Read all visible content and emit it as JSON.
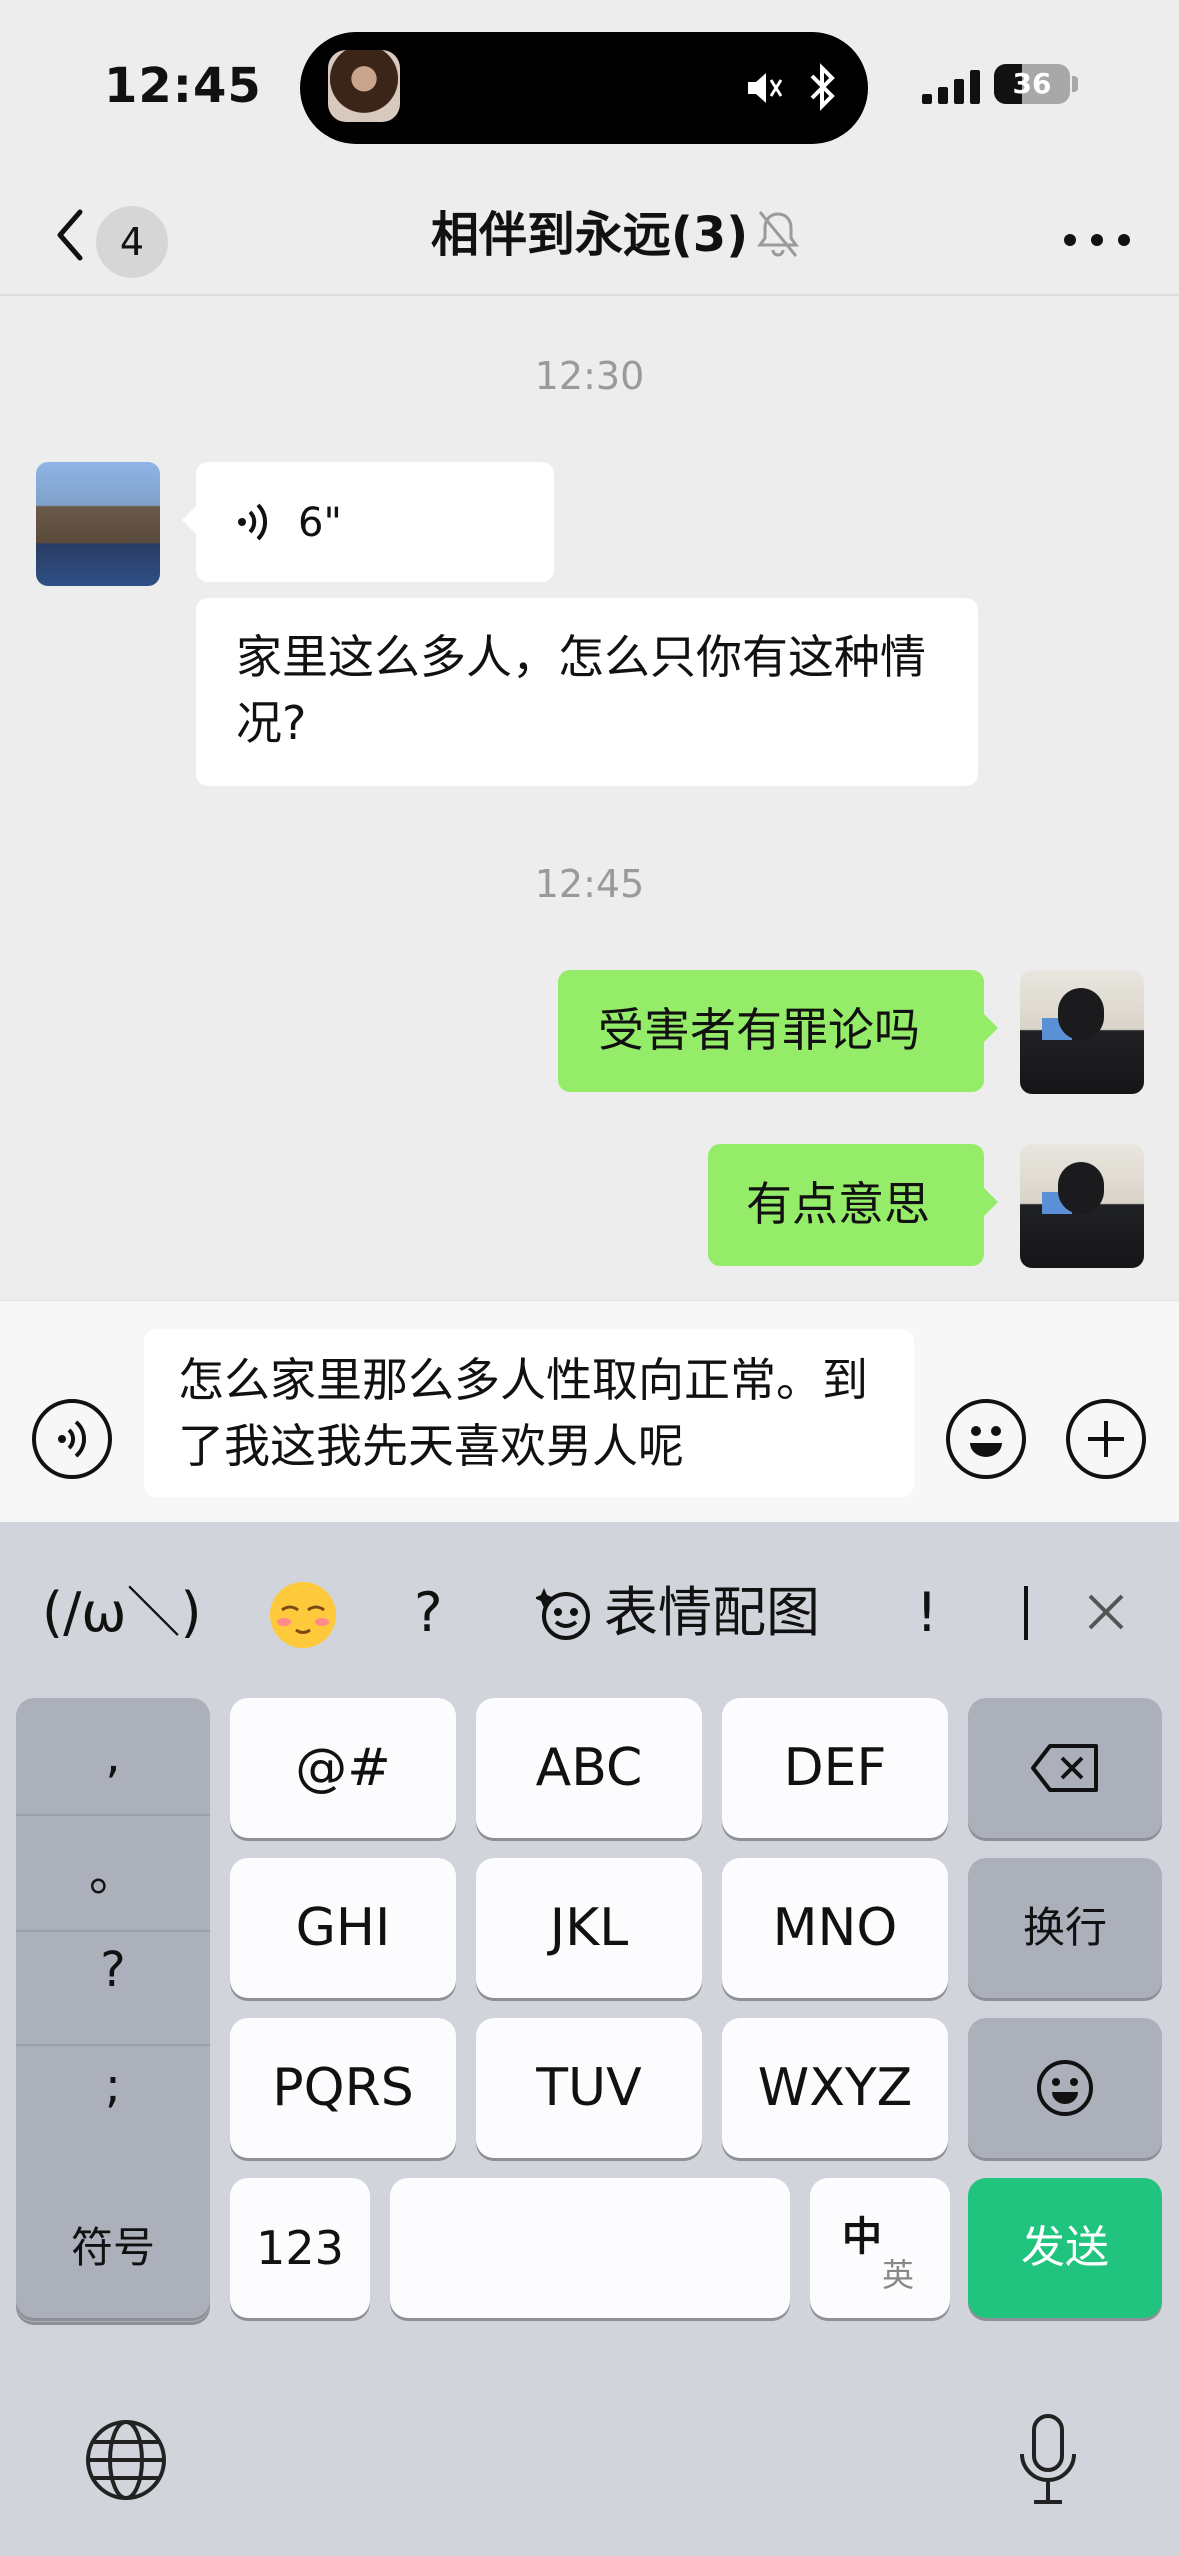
{
  "status_bar": {
    "time": "12:45",
    "battery": "36"
  },
  "nav": {
    "back_count": "4",
    "title": "相伴到永远(3)"
  },
  "chat": {
    "timestamp_1": "12:30",
    "voice_duration": "6\"",
    "incoming_text": "家里这么多人，怎么只你有这种情况?",
    "timestamp_2": "12:45",
    "outgoing_1": "受害者有罪论吗",
    "outgoing_2": "有点意思"
  },
  "input": {
    "text": "怎么家里那么多人性取向正常。到了我这我先天喜欢男人呢"
  },
  "candidates": {
    "kaomoji": "(/ω＼)",
    "question": "?",
    "sticker_label": "表情配图",
    "exclaim": "!"
  },
  "keyboard": {
    "punct": [
      ",",
      "。",
      "?",
      ";"
    ],
    "row1": [
      "@#",
      "ABC",
      "DEF"
    ],
    "row2": [
      "GHI",
      "JKL",
      "MNO"
    ],
    "row2_side": "换行",
    "row3": [
      "PQRS",
      "TUV",
      "WXYZ"
    ],
    "symbols": "符号",
    "numbers": "123",
    "lang_zh": "中",
    "lang_en": "英",
    "send": "发送"
  },
  "colors": {
    "chat_bg": "#ededed",
    "outgoing_bubble": "#95ec69",
    "send_button": "#21c47f",
    "keyboard_bg": "#d1d4db"
  }
}
